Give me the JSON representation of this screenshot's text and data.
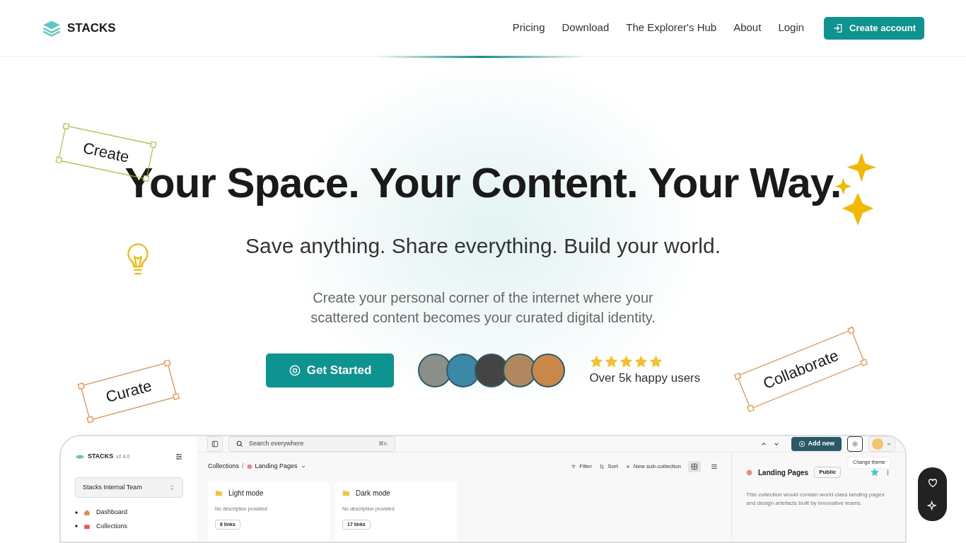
{
  "nav": {
    "logo": "STACKS",
    "links": [
      "Pricing",
      "Download",
      "The Explorer's Hub",
      "About",
      "Login"
    ],
    "cta": "Create account"
  },
  "hero": {
    "title": "Your Space. Your Content. Your Way.",
    "subtitle": "Save anything. Share everything. Build your world.",
    "description": "Create your personal corner of the internet where your scattered content becomes your curated digital identity.",
    "button": "Get Started",
    "stars": 5,
    "social_text": "Over 5k happy users"
  },
  "tags": [
    {
      "label": "Create",
      "color": "#84cc16"
    },
    {
      "label": "Curate",
      "color": "#f97316"
    },
    {
      "label": "Collaborate",
      "color": "#f97316"
    }
  ],
  "app": {
    "brand": "STACKS",
    "version": "v2.4.0",
    "team": "Stacks Internal Team",
    "nav_items": [
      "Dashboard",
      "Collections"
    ],
    "search": {
      "placeholder": "Search everywhere",
      "shortcut": "⌘K"
    },
    "add_button": "Add new",
    "tooltip": "Change theme",
    "breadcrumb": [
      "Collections",
      "Landing Pages"
    ],
    "breadcrumb_separator": "/",
    "toolbar": [
      "Filter",
      "Sort",
      "New sub-collection"
    ],
    "views": [
      {
        "kind": "grid",
        "selected": true
      },
      {
        "kind": "list",
        "selected": false
      }
    ],
    "cards": [
      {
        "title": "Light mode",
        "description": "No description provided",
        "links": "6 links"
      },
      {
        "title": "Dark mode",
        "description": "No description provided",
        "links": "17 links"
      }
    ],
    "panel": {
      "title": "Landing Pages",
      "badge": "Public",
      "starred": true,
      "description": "This collection would contain world class landing pages and design artefacts built by innovative teams."
    }
  }
}
